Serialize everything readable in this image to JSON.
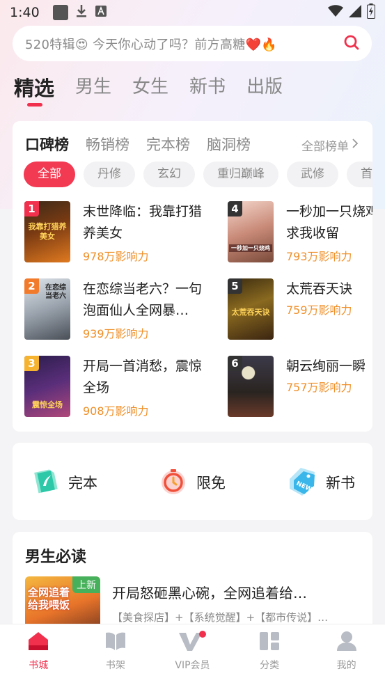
{
  "status_bar": {
    "time": "1:40"
  },
  "search": {
    "text": "520特辑😍 今天你心动了吗？前方高糖❤️🔥"
  },
  "main_tabs": [
    "精选",
    "男生",
    "女生",
    "新书",
    "出版"
  ],
  "ranking": {
    "tabs": [
      "口碑榜",
      "畅销榜",
      "完本榜",
      "脑洞榜"
    ],
    "all_rankings": "全部榜单",
    "chips": [
      "全部",
      "丹修",
      "玄幻",
      "重归巅峰",
      "武修",
      "首富"
    ],
    "books": [
      {
        "rank": "1",
        "title": "末世降临：我靠打猎养美女",
        "influence": "978万影响力",
        "cover_text": "我靠打猎养美女"
      },
      {
        "rank": "2",
        "title": "在恋综当老六？一句泡面仙人全网暴…",
        "influence": "939万影响力",
        "cover_text": "在恋综当老六"
      },
      {
        "rank": "3",
        "title": "开局一首消愁，震惊全场",
        "influence": "908万影响力",
        "cover_text": "震惊全场"
      },
      {
        "rank": "4",
        "title": "一秒加一只烧鸡，女神跪求我收留",
        "influence": "793万影响力",
        "cover_text": "一秒加一只烧鸡"
      },
      {
        "rank": "5",
        "title": "太荒吞天诀",
        "influence": "759万影响力",
        "cover_text": "太荒吞天诀"
      },
      {
        "rank": "6",
        "title": "朝云绚丽一瞬",
        "influence": "757万影响力",
        "cover_text": ""
      }
    ]
  },
  "quick_entries": [
    {
      "label": "完本",
      "icon": "book-complete-icon"
    },
    {
      "label": "限免",
      "icon": "stopwatch-icon"
    },
    {
      "label": "新书",
      "icon": "new-tag-icon"
    }
  ],
  "must_read": {
    "title": "男生必读",
    "book": {
      "title": "开局怒砸黑心碗，全网追着给…",
      "tags": "【美食探店】+【系统觉醒】+【都市传说】…",
      "badge": "上新",
      "cover_text": "全网追着给我喂饭"
    }
  },
  "bottom_nav": [
    {
      "label": "书城",
      "icon": "bookstore-icon",
      "active": true
    },
    {
      "label": "书架",
      "icon": "bookshelf-icon",
      "active": false
    },
    {
      "label": "VIP会员",
      "icon": "vip-icon",
      "active": false
    },
    {
      "label": "分类",
      "icon": "category-icon",
      "active": false
    },
    {
      "label": "我的",
      "icon": "profile-icon",
      "active": false
    }
  ],
  "colors": {
    "accent": "#f0304d",
    "influence": "#f0902a",
    "rank1": "#f0304d",
    "rank2": "#f27a2b",
    "rank3": "#f5b330",
    "rank_other": "#333333"
  }
}
